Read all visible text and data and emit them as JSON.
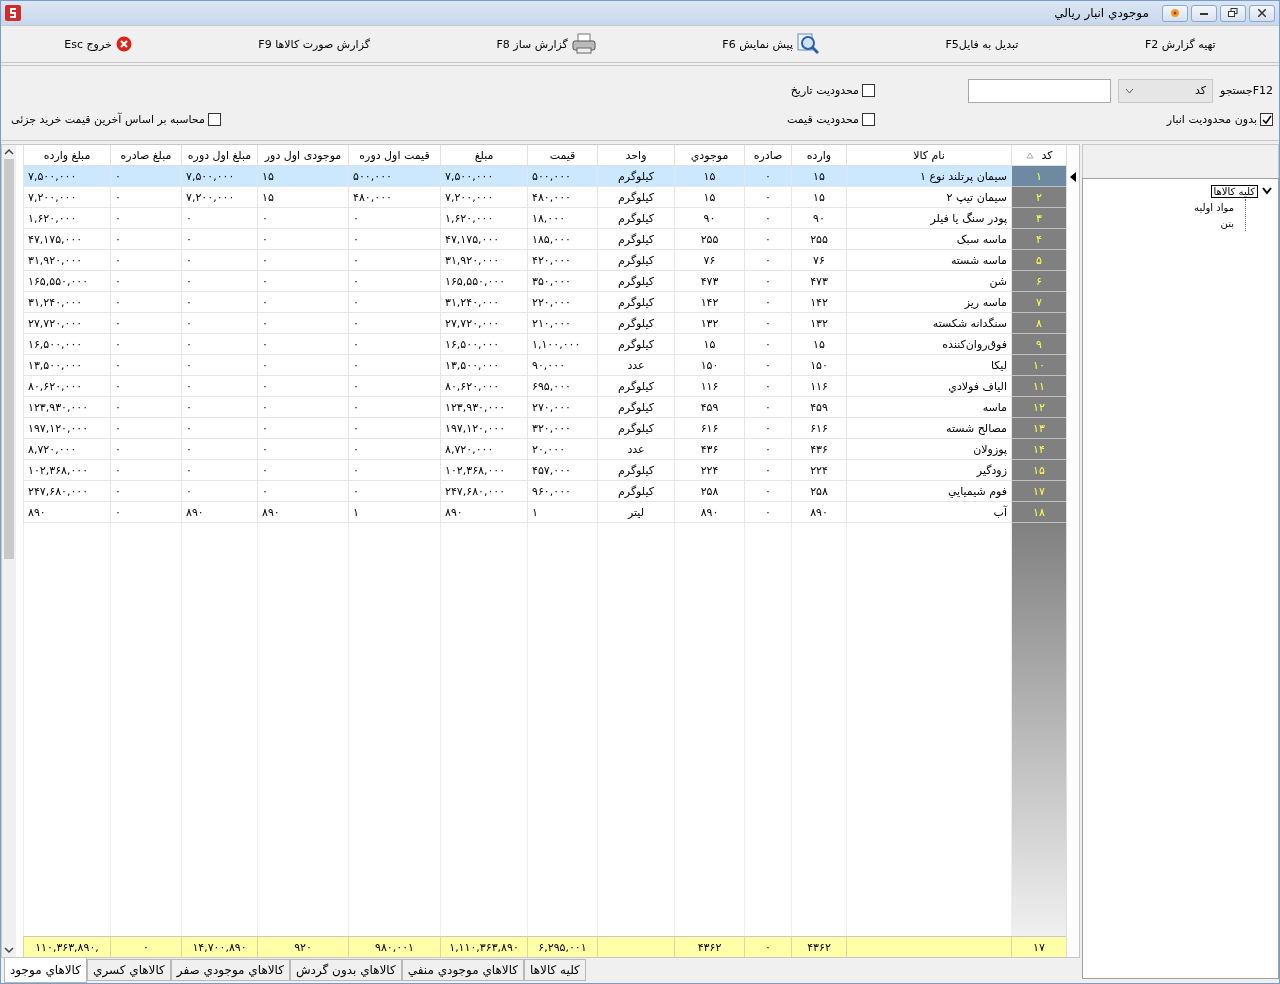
{
  "window": {
    "title": "موجودي انبار ريالي"
  },
  "toolbar": [
    {
      "label": "تهیه گزارش F2",
      "kind": "text"
    },
    {
      "label": "تبدیل به فایلF5",
      "kind": "text"
    },
    {
      "label": "پیش نمایش F6",
      "kind": "preview"
    },
    {
      "label": "گزارش ساز F8",
      "kind": "print"
    },
    {
      "label": "گزارش صورت کالاها F9",
      "kind": "text"
    },
    {
      "label": "خروج Esc",
      "kind": "exit"
    }
  ],
  "filters": {
    "search_label": "F12جستجو",
    "search_by": "کد",
    "checkboxes": [
      {
        "label": "محدودیت تاریخ",
        "checked": false
      },
      {
        "label": "بدون محدودیت انبار",
        "checked": true
      },
      {
        "label": "محدودیت قیمت",
        "checked": false
      },
      {
        "label": "محاسبه بر اساس آخرین قیمت خرید جزئی",
        "checked": false
      }
    ]
  },
  "table": {
    "columns": [
      {
        "label": "کد",
        "sort_ascending": true
      },
      {
        "label": "نام کالا",
        "sort_ascending": false
      },
      {
        "label": "وارده",
        "sort_ascending": false
      },
      {
        "label": "صادره",
        "sort_ascending": false
      },
      {
        "label": "موجودي",
        "sort_ascending": false
      },
      {
        "label": "واحد",
        "sort_ascending": false
      },
      {
        "label": "قیمت",
        "sort_ascending": false
      },
      {
        "label": "مبلغ",
        "sort_ascending": false
      },
      {
        "label": "قیمت اول دوره",
        "sort_ascending": false
      },
      {
        "label": "موجودی اول دور",
        "sort_ascending": false
      },
      {
        "label": "مبلغ اول دوره",
        "sort_ascending": false
      },
      {
        "label": "مبلغ صادره",
        "sort_ascending": false
      },
      {
        "label": "مبلغ وارده",
        "sort_ascending": false
      }
    ],
    "rows": [
      {
        "selected": true,
        "cells": [
          "۱",
          "سیمان پرتلند نوع ۱",
          "۱۵",
          "۰",
          "۱۵",
          "کیلوگرم",
          "۵۰۰,۰۰۰",
          "۷,۵۰۰,۰۰۰",
          "۵۰۰,۰۰۰",
          "۱۵",
          "۷,۵۰۰,۰۰۰",
          "۰",
          "۷,۵۰۰,۰۰۰"
        ]
      },
      {
        "selected": false,
        "cells": [
          "۲",
          "سیمان تیپ ۲",
          "۱۵",
          "۰",
          "۱۵",
          "کیلوگرم",
          "۴۸۰,۰۰۰",
          "۷,۲۰۰,۰۰۰",
          "۴۸۰,۰۰۰",
          "۱۵",
          "۷,۲۰۰,۰۰۰",
          "۰",
          "۷,۲۰۰,۰۰۰"
        ]
      },
      {
        "selected": false,
        "cells": [
          "۳",
          "پودر سنگ یا فیلر",
          "۹۰",
          "۰",
          "۹۰",
          "کیلوگرم",
          "۱۸,۰۰۰",
          "۱,۶۲۰,۰۰۰",
          "۰",
          "۰",
          "۰",
          "۰",
          "۱,۶۲۰,۰۰۰"
        ]
      },
      {
        "selected": false,
        "cells": [
          "۴",
          "ماسه سبک",
          "۲۵۵",
          "۰",
          "۲۵۵",
          "کیلوگرم",
          "۱۸۵,۰۰۰",
          "۴۷,۱۷۵,۰۰۰",
          "۰",
          "۰",
          "۰",
          "۰",
          "۴۷,۱۷۵,۰۰۰"
        ]
      },
      {
        "selected": false,
        "cells": [
          "۵",
          "ماسه شسته",
          "۷۶",
          "۰",
          "۷۶",
          "کیلوگرم",
          "۴۲۰,۰۰۰",
          "۳۱,۹۲۰,۰۰۰",
          "۰",
          "۰",
          "۰",
          "۰",
          "۳۱,۹۲۰,۰۰۰"
        ]
      },
      {
        "selected": false,
        "cells": [
          "۶",
          "شن",
          "۴۷۳",
          "۰",
          "۴۷۳",
          "کیلوگرم",
          "۳۵۰,۰۰۰",
          "۱۶۵,۵۵۰,۰۰۰",
          "۰",
          "۰",
          "۰",
          "۰",
          "۱۶۵,۵۵۰,۰۰۰"
        ]
      },
      {
        "selected": false,
        "cells": [
          "۷",
          "ماسه ریز",
          "۱۴۲",
          "۰",
          "۱۴۲",
          "کیلوگرم",
          "۲۲۰,۰۰۰",
          "۳۱,۲۴۰,۰۰۰",
          "۰",
          "۰",
          "۰",
          "۰",
          "۳۱,۲۴۰,۰۰۰"
        ]
      },
      {
        "selected": false,
        "cells": [
          "۸",
          "سنگدانه شکسته",
          "۱۳۲",
          "۰",
          "۱۳۲",
          "کیلوگرم",
          "۲۱۰,۰۰۰",
          "۲۷,۷۲۰,۰۰۰",
          "۰",
          "۰",
          "۰",
          "۰",
          "۲۷,۷۲۰,۰۰۰"
        ]
      },
      {
        "selected": false,
        "cells": [
          "۹",
          "فوق‌روان‌کننده",
          "۱۵",
          "۰",
          "۱۵",
          "کیلوگرم",
          "۱,۱۰۰,۰۰۰",
          "۱۶,۵۰۰,۰۰۰",
          "۰",
          "۰",
          "۰",
          "۰",
          "۱۶,۵۰۰,۰۰۰"
        ]
      },
      {
        "selected": false,
        "cells": [
          "۱۰",
          "لیکا",
          "۱۵۰",
          "۰",
          "۱۵۰",
          "عدد",
          "۹۰,۰۰۰",
          "۱۳,۵۰۰,۰۰۰",
          "۰",
          "۰",
          "۰",
          "۰",
          "۱۳,۵۰۰,۰۰۰"
        ]
      },
      {
        "selected": false,
        "cells": [
          "۱۱",
          "الیاف فولادي",
          "۱۱۶",
          "۰",
          "۱۱۶",
          "کیلوگرم",
          "۶۹۵,۰۰۰",
          "۸۰,۶۲۰,۰۰۰",
          "۰",
          "۰",
          "۰",
          "۰",
          "۸۰,۶۲۰,۰۰۰"
        ]
      },
      {
        "selected": false,
        "cells": [
          "۱۲",
          "ماسه",
          "۴۵۹",
          "۰",
          "۴۵۹",
          "کیلوگرم",
          "۲۷۰,۰۰۰",
          "۱۲۳,۹۳۰,۰۰۰",
          "۰",
          "۰",
          "۰",
          "۰",
          "۱۲۳,۹۳۰,۰۰۰"
        ]
      },
      {
        "selected": false,
        "cells": [
          "۱۳",
          "مصالح شسته",
          "۶۱۶",
          "۰",
          "۶۱۶",
          "کیلوگرم",
          "۳۲۰,۰۰۰",
          "۱۹۷,۱۲۰,۰۰۰",
          "۰",
          "۰",
          "۰",
          "۰",
          "۱۹۷,۱۲۰,۰۰۰"
        ]
      },
      {
        "selected": false,
        "cells": [
          "۱۴",
          "پوزولان",
          "۴۳۶",
          "۰",
          "۴۳۶",
          "عدد",
          "۲۰,۰۰۰",
          "۸,۷۲۰,۰۰۰",
          "۰",
          "۰",
          "۰",
          "۰",
          "۸,۷۲۰,۰۰۰"
        ]
      },
      {
        "selected": false,
        "cells": [
          "۱۵",
          "زودگیر",
          "۲۲۴",
          "۰",
          "۲۲۴",
          "کیلوگرم",
          "۴۵۷,۰۰۰",
          "۱۰۲,۳۶۸,۰۰۰",
          "۰",
          "۰",
          "۰",
          "۰",
          "۱۰۲,۳۶۸,۰۰۰"
        ]
      },
      {
        "selected": false,
        "cells": [
          "۱۷",
          "فوم شیمیایي",
          "۲۵۸",
          "۰",
          "۲۵۸",
          "کیلوگرم",
          "۹۶۰,۰۰۰",
          "۲۴۷,۶۸۰,۰۰۰",
          "۰",
          "۰",
          "۰",
          "۰",
          "۲۴۷,۶۸۰,۰۰۰"
        ]
      },
      {
        "selected": false,
        "cells": [
          "۱۸",
          "آب",
          "۸۹۰",
          "۰",
          "۸۹۰",
          "لیتر",
          "۱",
          "۸۹۰",
          "۱",
          "۸۹۰",
          "۸۹۰",
          "۰",
          "۸۹۰"
        ]
      }
    ],
    "totals": {
      "count": "۱۷",
      "in": "۴۳۶۲",
      "out": "۰",
      "stock": "۴۳۶۲",
      "price": "۶,۲۹۵,۰۰۱",
      "amount": "۱,۱۱۰,۳۶۳,۸۹۰",
      "open_price": "۹۸۰,۰۰۱",
      "open_stock": "۹۲۰",
      "open_amount": "۱۴,۷۰۰,۸۹۰",
      "out_amount": "۰",
      "in_amount": ",۱۱۰,۳۶۳,۸۹۰"
    }
  },
  "tree": [
    {
      "label": "کلیه کالاها",
      "expanded": true,
      "selected": true,
      "children": [
        {
          "label": "مواد اولیه",
          "selected": false
        },
        {
          "label": "بتن",
          "selected": false
        }
      ]
    }
  ],
  "tabs": [
    {
      "label": "کلیه کالاها",
      "selected": false
    },
    {
      "label": "کالاهاي موجودي منفي",
      "selected": false
    },
    {
      "label": "کالاهاي بدون گردش",
      "selected": false
    },
    {
      "label": "کالاهاي موجودي صفر",
      "selected": false
    },
    {
      "label": "کالاهاي کسري",
      "selected": false
    },
    {
      "label": "کالاهاي موجود",
      "selected": true
    }
  ]
}
